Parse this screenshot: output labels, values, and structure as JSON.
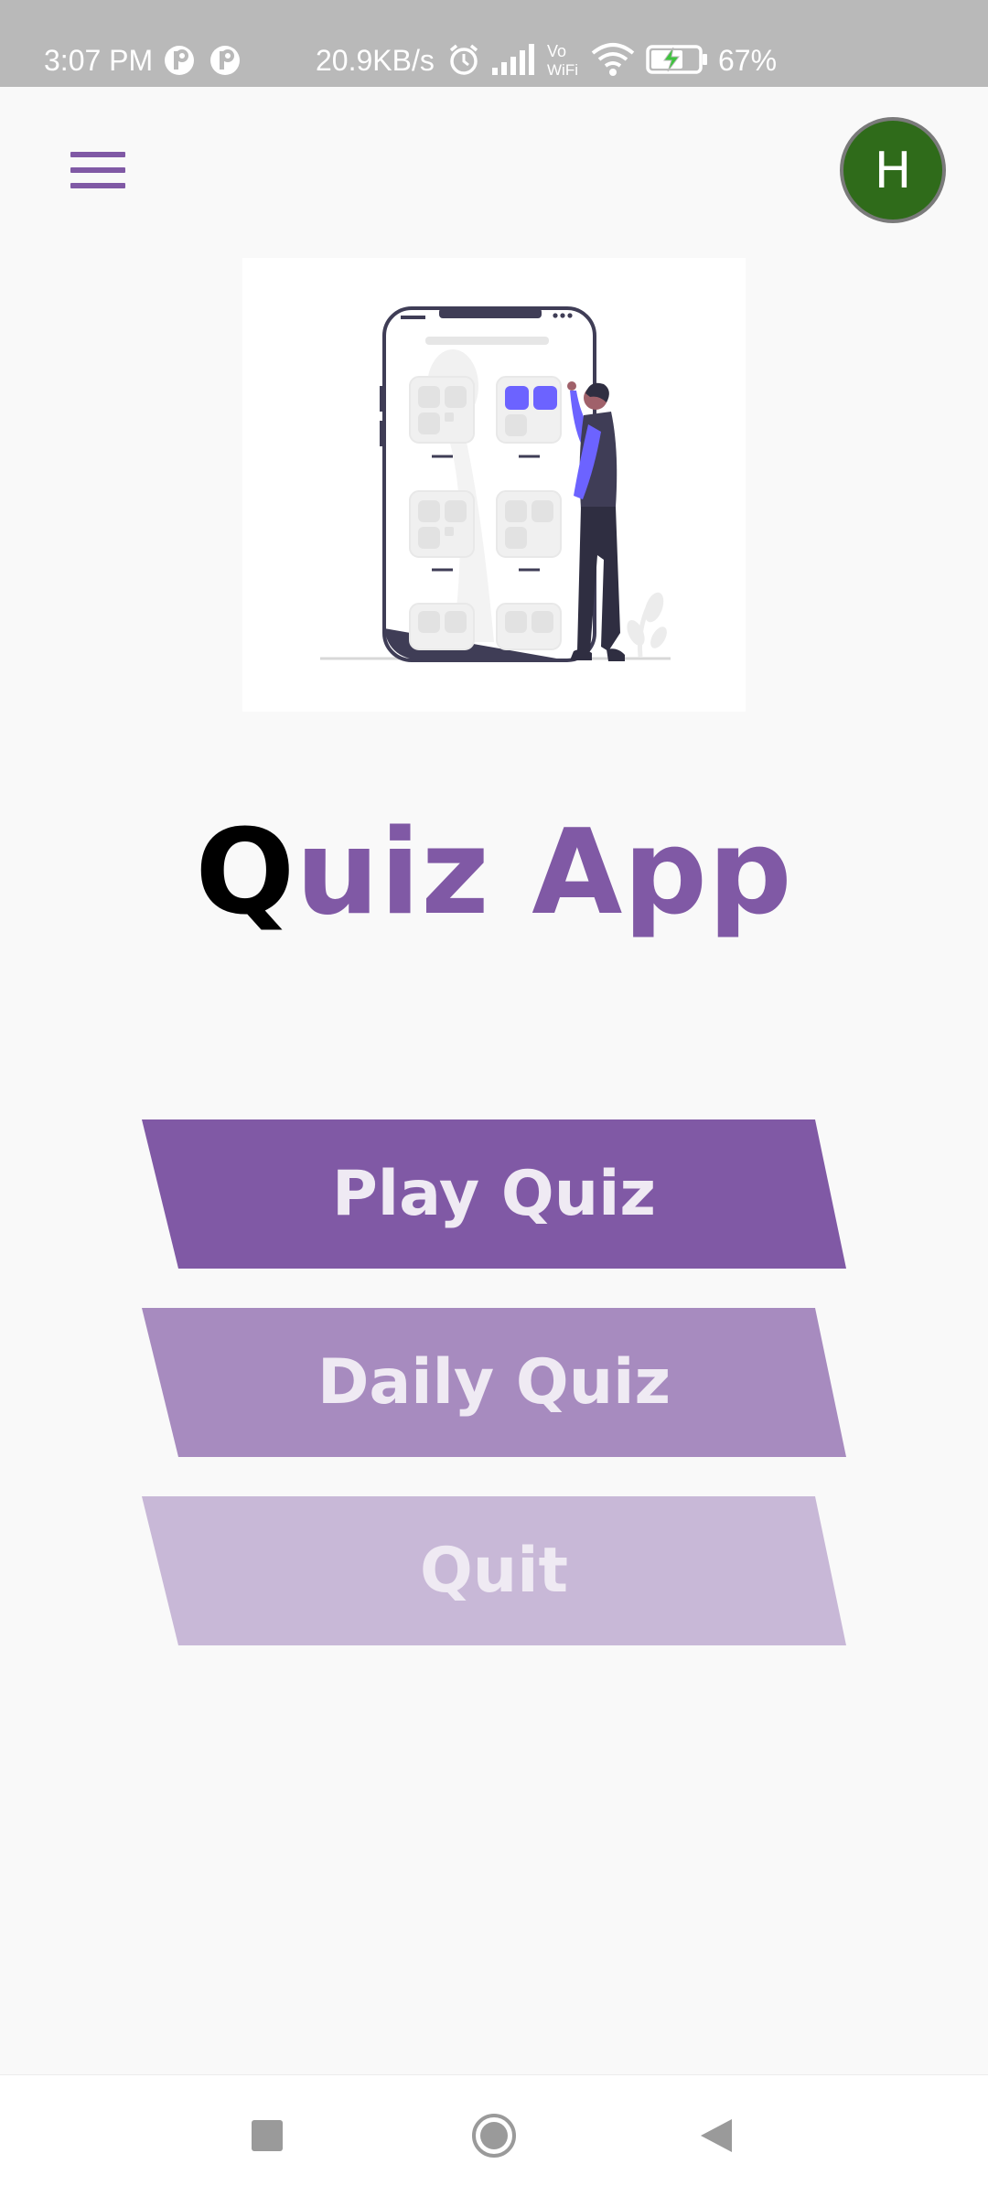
{
  "status_bar": {
    "time": "3:07 PM",
    "network_speed": "20.9KB/s",
    "battery_percent": "67%",
    "icons": [
      "notification-icon",
      "notification-icon",
      "alarm-icon",
      "signal-icon",
      "vowifi-icon",
      "wifi-icon",
      "battery-charging-icon"
    ]
  },
  "header": {
    "menu_icon": "hamburger-menu-icon",
    "avatar_initial": "H",
    "avatar_color": "#2f6b1a"
  },
  "hero": {
    "illustration": "person-using-phone-illustration"
  },
  "app_title": {
    "first_letter": "Q",
    "rest": "uiz App"
  },
  "menu": {
    "buttons": [
      {
        "label": "Play Quiz",
        "color": "#8059a5"
      },
      {
        "label": "Daily Quiz",
        "color": "#a78bbf"
      },
      {
        "label": "Quit",
        "color": "#c8b8d7"
      }
    ]
  },
  "navigation": {
    "icons": [
      "recents-square-icon",
      "home-circle-icon",
      "back-triangle-icon"
    ]
  },
  "colors": {
    "accent": "#8059a5",
    "background": "#f9f9f9",
    "status_bar": "#b9b9b9"
  }
}
